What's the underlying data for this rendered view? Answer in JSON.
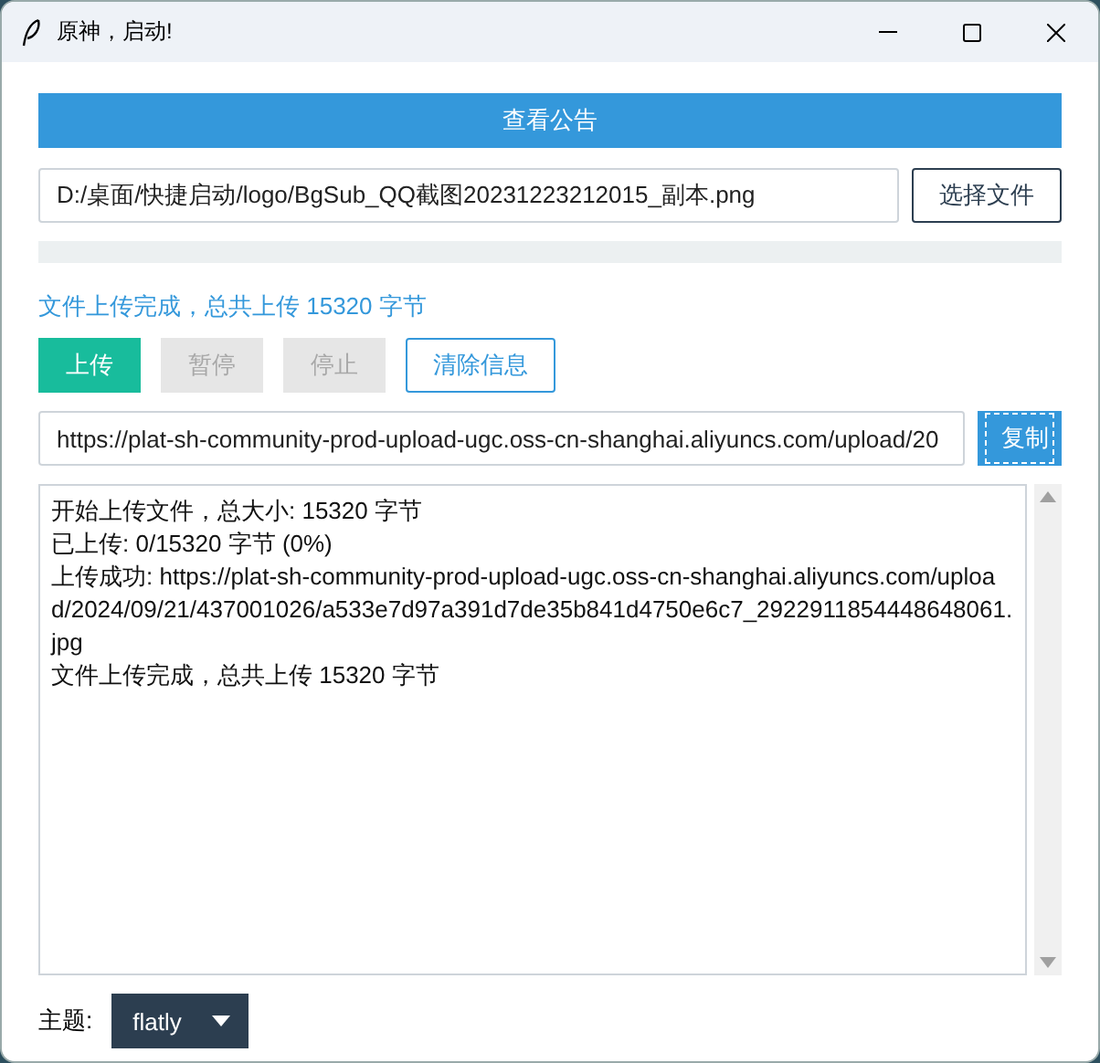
{
  "window": {
    "title": "原神，启动!"
  },
  "notice_button": {
    "label": "查看公告"
  },
  "file_path": {
    "value": "D:/桌面/快捷启动/logo/BgSub_QQ截图20231223212015_副本.png"
  },
  "choose_file_button": {
    "label": "选择文件"
  },
  "progress": {
    "level": 0
  },
  "status_text": "文件上传完成，总共上传 15320 字节",
  "actions": [
    {
      "label": "上传",
      "kind": "success",
      "disabled": false
    },
    {
      "label": "暂停",
      "kind": "success",
      "disabled": true
    },
    {
      "label": "停止",
      "kind": "success",
      "disabled": true
    },
    {
      "label": "清除信息",
      "kind": "outline",
      "disabled": false
    }
  ],
  "url_field": {
    "value": "https://plat-sh-community-prod-upload-ugc.oss-cn-shanghai.aliyuncs.com/upload/20"
  },
  "copy_button": {
    "label": "复制",
    "focused": true
  },
  "log_lines": [
    "开始上传文件，总大小: 15320 字节",
    "已上传: 0/15320 字节 (0%)",
    "上传成功: https://plat-sh-community-prod-upload-ugc.oss-cn-shanghai.aliyuncs.com/upload/2024/09/21/437001026/a533e7d97a391d7de35b841d4750e6c7_2922911854448648061.jpg",
    "文件上传完成，总共上传 15320 字节"
  ],
  "theme": {
    "label": "主题:",
    "value": "flatly"
  }
}
